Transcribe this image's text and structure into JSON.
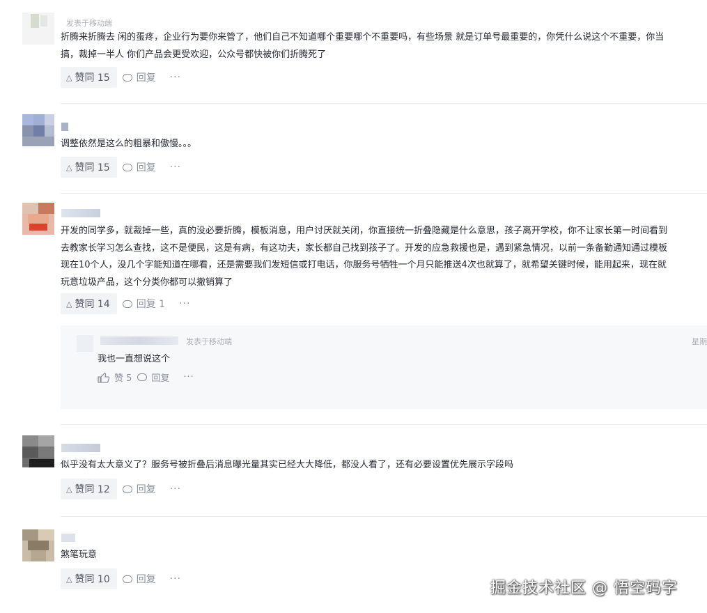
{
  "comments": [
    {
      "meta": "发表于移动端",
      "lines": [
        "折腾来折腾去 闲的蛋疼，企业行为要你来管了，他们自己不知道哪个重要哪个不重要吗，有些场景 就是订单号最重要的，你凭什么说这个不重要，你当",
        "搞，裁掉一半人 你们产品会更受欢迎，公众号都快被你们折腾死了"
      ],
      "like_label": "赞同 15",
      "reply_label": "回复",
      "more": "···"
    },
    {
      "lines": [
        "调整依然是这么的粗暴和傲慢。。。"
      ],
      "like_label": "赞同 15",
      "reply_label": "回复",
      "more": "···"
    },
    {
      "lines": [
        "开发的同学多，就裁掉一些，真的没必要折腾，模板消息，用户讨厌就关闭，你直接统一折叠隐藏是什么意思，孩子离开学校，你不让家长第一时间看到",
        "去教家长学习怎么查找，这不是便民，这是有病，有这功夫，家长都自己找到孩子了。开发的应急救援也是，遇到紧急情况，以前一条备勤通知通过模板",
        "现在10个人，没几个字能知道在哪看，还是需要我们发短信或打电话，你服务号牺牲一个月只能推送4次也就算了，就希望关键时候，能用起来，现在就",
        "玩意垃圾产品，这个分类你都可以撤销算了"
      ],
      "like_label": "赞同 14",
      "reply_label": "回复 1",
      "more": "···",
      "sub_reply": {
        "meta": "发表于移动端",
        "right_text": "星期",
        "text": "我也一直想说这个",
        "like_label": "赞 5",
        "reply_label": "回复",
        "more": "···"
      }
    },
    {
      "lines": [
        "似乎没有太大意义了？服务号被折叠后消息曝光量其实已经大大降低，都没人看了，还有必要设置优先展示字段吗"
      ],
      "like_label": "赞同 12",
      "reply_label": "回复",
      "more": "···"
    },
    {
      "lines": [
        "煞笔玩意"
      ],
      "like_label": "赞同 10",
      "reply_label": "回复",
      "more": "···"
    }
  ],
  "watermark": "掘金技术社区 @ 悟空码字"
}
